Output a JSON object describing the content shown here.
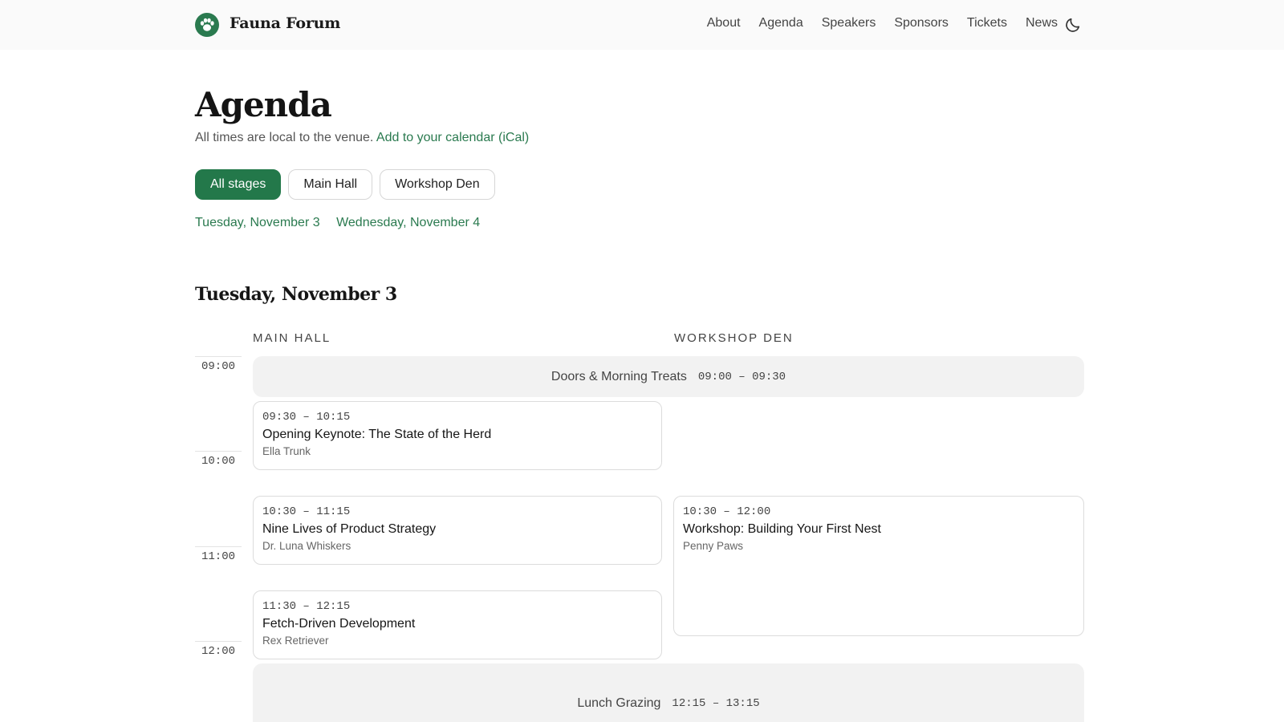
{
  "site": {
    "name": "Fauna Forum"
  },
  "nav": [
    "About",
    "Agenda",
    "Speakers",
    "Sponsors",
    "Tickets",
    "News"
  ],
  "page": {
    "title": "Agenda",
    "subtitle_text": "All times are local to the venue.",
    "calendar_link": "Add to your calendar (iCal)"
  },
  "filters": [
    {
      "label": "All stages",
      "active": true
    },
    {
      "label": "Main Hall",
      "active": false
    },
    {
      "label": "Workshop Den",
      "active": false
    }
  ],
  "day_links": [
    "Tuesday, November 3",
    "Wednesday, November 4"
  ],
  "schedule": {
    "day_heading": "Tuesday, November 3",
    "columns": [
      "MAIN HALL",
      "WORKSHOP DEN"
    ],
    "hours": [
      "09:00",
      "10:00",
      "11:00",
      "12:00"
    ],
    "breaks": [
      {
        "title": "Doors & Morning Treats",
        "time": "09:00 – 09:30"
      },
      {
        "title": "Lunch Grazing",
        "time": "12:15 – 13:15"
      }
    ],
    "sessions": [
      {
        "time": "09:30 – 10:15",
        "title": "Opening Keynote: The State of the Herd",
        "speaker": "Ella Trunk",
        "stage": "Main Hall"
      },
      {
        "time": "10:30 – 11:15",
        "title": "Nine Lives of Product Strategy",
        "speaker": "Dr. Luna Whiskers",
        "stage": "Main Hall"
      },
      {
        "time": "11:30 – 12:15",
        "title": "Fetch-Driven Development",
        "speaker": "Rex Retriever",
        "stage": "Main Hall"
      },
      {
        "time": "10:30 – 12:00",
        "title": "Workshop: Building Your First Nest",
        "speaker": "Penny Paws",
        "stage": "Workshop Den"
      }
    ]
  },
  "colors": {
    "accent": "#23784a",
    "link": "#2a7a4f",
    "break_bg": "#f2f2f2"
  },
  "icons": {
    "logo": "paw-icon",
    "theme_toggle": "moon-icon"
  }
}
